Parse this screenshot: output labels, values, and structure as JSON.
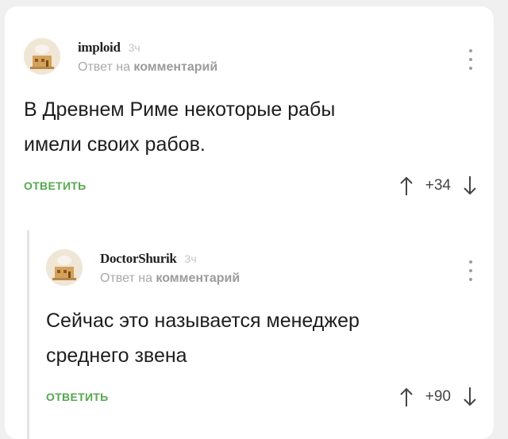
{
  "comments": [
    {
      "username": "imploid",
      "time": "3ч",
      "reply_prefix": "Ответ на",
      "reply_target": "комментарий",
      "text_line1": "В Древнем Риме некоторые рабы",
      "text_line2": "имели своих рабов.",
      "reply_label": "ОТВЕТИТЬ",
      "score": "+34"
    },
    {
      "username": "DoctorShurik",
      "time": "3ч",
      "reply_prefix": "Ответ на",
      "reply_target": "комментарий",
      "text_line1": "Сейчас это называется менеджер",
      "text_line2": "среднего звена",
      "reply_label": "ОТВЕТИТЬ",
      "score": "+90"
    }
  ],
  "colors": {
    "accent_green": "#55a84e",
    "meta_grey": "#a8a8a8",
    "background": "#ffffff"
  },
  "icons": [
    "avatar-icon",
    "more-menu-icon",
    "upvote-arrow-icon",
    "downvote-arrow-icon"
  ]
}
